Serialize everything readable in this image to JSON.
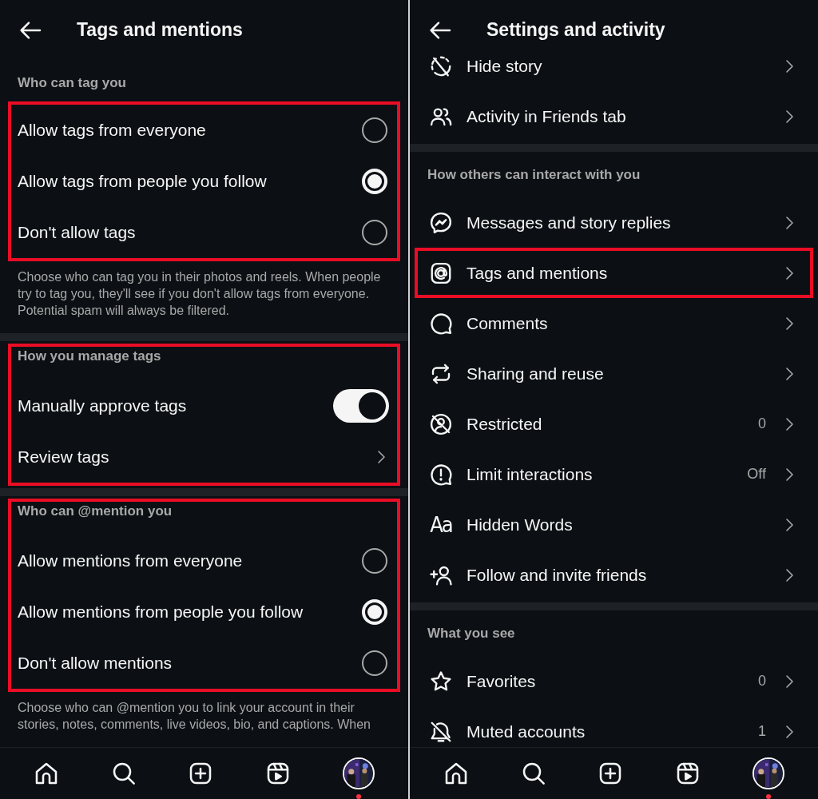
{
  "screens": [
    {
      "title": "Tags and mentions",
      "sections": [
        {
          "label": "Who can tag you",
          "highlighted": false
        },
        {
          "highlighted": true,
          "rows": [
            {
              "kind": "radio",
              "label": "Allow tags from everyone",
              "selected": false,
              "highlighted": false
            },
            {
              "kind": "radio",
              "label": "Allow tags from people you follow",
              "selected": true,
              "highlighted": false
            },
            {
              "kind": "radio",
              "label": "Don't allow tags",
              "selected": false,
              "highlighted": false
            }
          ],
          "description": "Choose who can tag you in their photos and reels. When people try to tag you, they'll see if you don't allow tags from everyone. Potential spam will always be filtered."
        },
        {
          "label": "How you manage tags",
          "highlighted": true,
          "rows": [
            {
              "kind": "toggle",
              "label": "Manually approve tags",
              "on": true,
              "highlighted": false
            },
            {
              "kind": "link",
              "label": "Review tags",
              "highlighted": false
            }
          ]
        },
        {
          "label": "Who can @mention you",
          "highlighted": true,
          "rows": [
            {
              "kind": "radio",
              "label": "Allow mentions from everyone",
              "selected": false,
              "highlighted": false
            },
            {
              "kind": "radio",
              "label": "Allow mentions from people you follow",
              "selected": true,
              "highlighted": false
            },
            {
              "kind": "radio",
              "label": "Don't allow mentions",
              "selected": false,
              "highlighted": false
            }
          ],
          "description": "Choose who can @mention you to link your account in their stories, notes, comments, live videos, bio, and captions. When"
        }
      ],
      "profile_badge": true
    },
    {
      "title": "Settings and activity",
      "sections": [
        {
          "highlighted": false,
          "rows": [
            {
              "kind": "link",
              "label": "Hide story",
              "highlighted": false
            },
            {
              "kind": "link",
              "label": "Activity in Friends tab",
              "highlighted": false
            }
          ]
        },
        {
          "label": "How others can interact with you",
          "highlighted": false,
          "rows": [
            {
              "kind": "link",
              "label": "Messages and story replies",
              "highlighted": false
            },
            {
              "kind": "link",
              "label": "Tags and mentions",
              "highlighted": true
            },
            {
              "kind": "link",
              "label": "Comments",
              "highlighted": false
            },
            {
              "kind": "link",
              "label": "Sharing and reuse",
              "highlighted": false
            },
            {
              "kind": "link",
              "label": "Restricted",
              "value": "0",
              "highlighted": false
            },
            {
              "kind": "link",
              "label": "Limit interactions",
              "value": "Off",
              "highlighted": false
            },
            {
              "kind": "link",
              "label": "Hidden Words",
              "glyph": "Aa",
              "highlighted": false
            },
            {
              "kind": "link",
              "label": "Follow and invite friends",
              "highlighted": false
            }
          ]
        },
        {
          "label": "What you see",
          "highlighted": false,
          "rows": [
            {
              "kind": "link",
              "label": "Favorites",
              "value": "0",
              "highlighted": false
            },
            {
              "kind": "link",
              "label": "Muted accounts",
              "value": "1",
              "highlighted": false
            }
          ]
        }
      ],
      "profile_badge": true
    }
  ]
}
